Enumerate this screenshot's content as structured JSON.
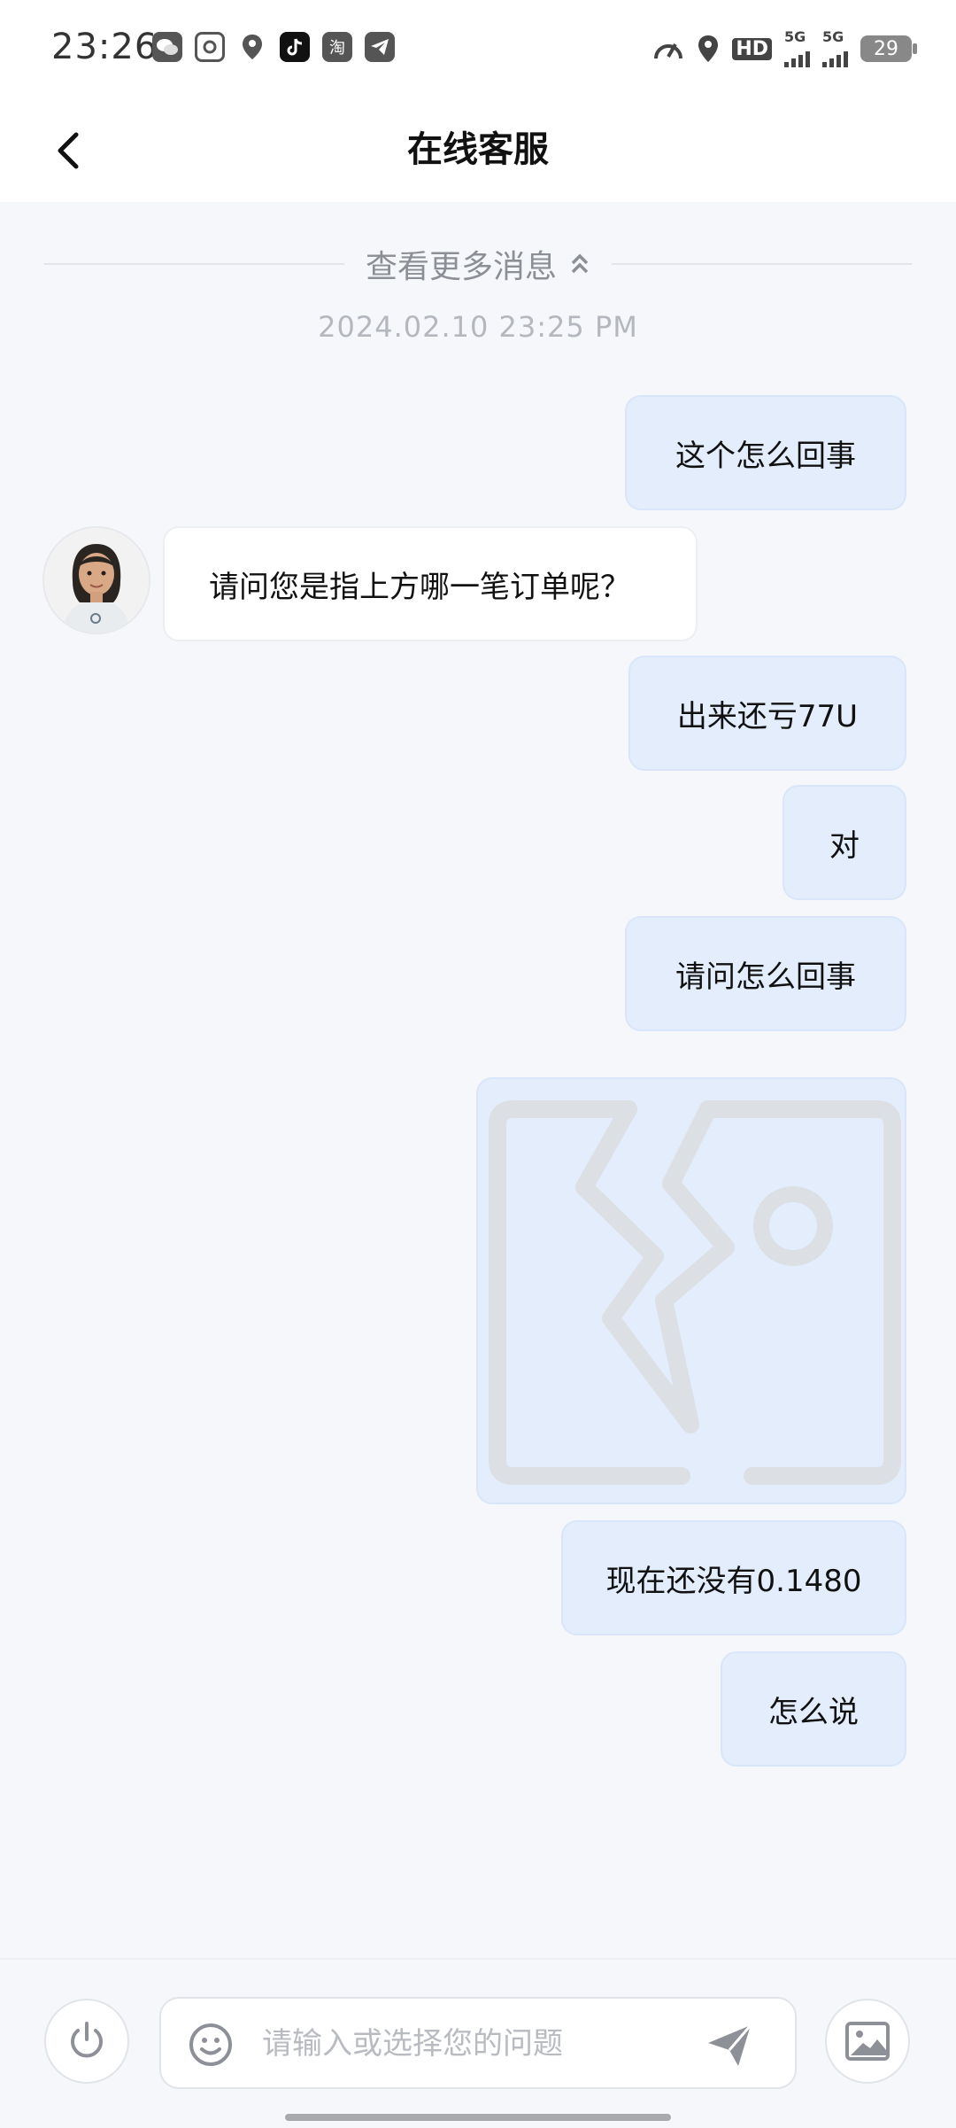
{
  "status_bar": {
    "time": "23:26",
    "app_icons": [
      "wechat-icon",
      "du-app-icon",
      "du-map-icon",
      "tiktok-icon",
      "taobao-icon",
      "telegram-icon"
    ],
    "taobao_label": "淘",
    "network_labels": [
      "HD",
      "5G",
      "5G"
    ],
    "battery": "29"
  },
  "nav": {
    "title": "在线客服",
    "back_icon": "chevron-left-icon"
  },
  "chat": {
    "load_more": "查看更多消息",
    "timestamp": "2024.02.10 23:25 PM",
    "messages": [
      {
        "from": "me",
        "text": "这个怎么回事"
      },
      {
        "from": "agent",
        "text": "请问您是指上方哪一笔订单呢？"
      },
      {
        "from": "me",
        "text": "出来还亏77U"
      },
      {
        "from": "me",
        "text": "对"
      },
      {
        "from": "me",
        "text": "请问怎么回事"
      },
      {
        "from": "me",
        "type": "image",
        "state": "broken-image"
      },
      {
        "from": "me",
        "text": "现在还没有0.1480"
      },
      {
        "from": "me",
        "text": "怎么说"
      }
    ]
  },
  "input_bar": {
    "placeholder": "请输入或选择您的问题",
    "power_icon": "power-icon",
    "emoji_icon": "smiley-icon",
    "send_icon": "send-icon",
    "image_icon": "image-icon"
  },
  "colors": {
    "background": "#f5f7fa",
    "my_bubble": "#e3edfc",
    "agent_bubble": "#ffffff"
  }
}
